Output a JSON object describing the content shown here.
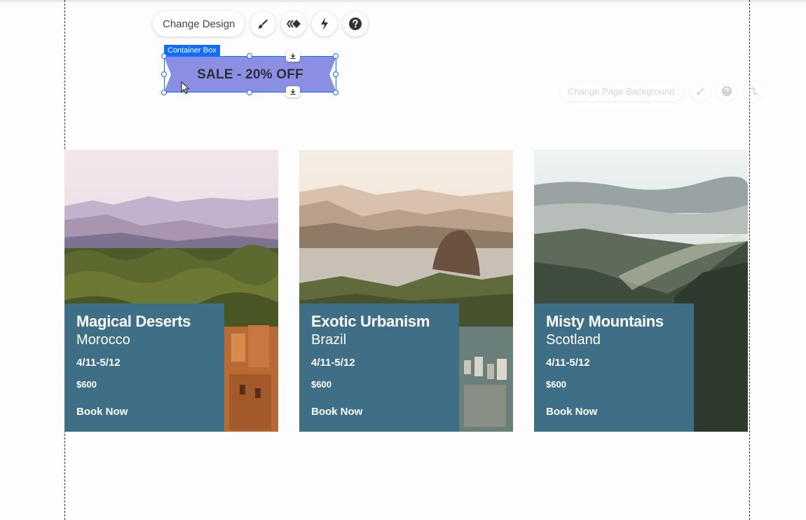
{
  "toolbar": {
    "change_design": "Change Design",
    "icons": [
      "brush-icon",
      "animation-icon",
      "lightning-icon",
      "help-icon"
    ]
  },
  "page_toolbar": {
    "change_background": "Change Page Background",
    "icons": [
      "brush-icon",
      "help-icon",
      "stretch-icon"
    ]
  },
  "selection": {
    "label": "Container Box",
    "banner_text": "SALE - 20% OFF",
    "banner_color": "#8b8fe3",
    "selection_color": "#116dff"
  },
  "cards": [
    {
      "title": "Magical Deserts",
      "place": "Morocco",
      "dates": "4/11-5/12",
      "price": "$600",
      "cta": "Book Now"
    },
    {
      "title": "Exotic Urbanism",
      "place": "Brazil",
      "dates": "4/11-5/12",
      "price": "$600",
      "cta": "Book Now"
    },
    {
      "title": "Misty Mountains",
      "place": "Scotland",
      "dates": "4/11-5/12",
      "price": "$600",
      "cta": "Book Now"
    }
  ],
  "colors": {
    "card_panel": "#3e6f87"
  }
}
